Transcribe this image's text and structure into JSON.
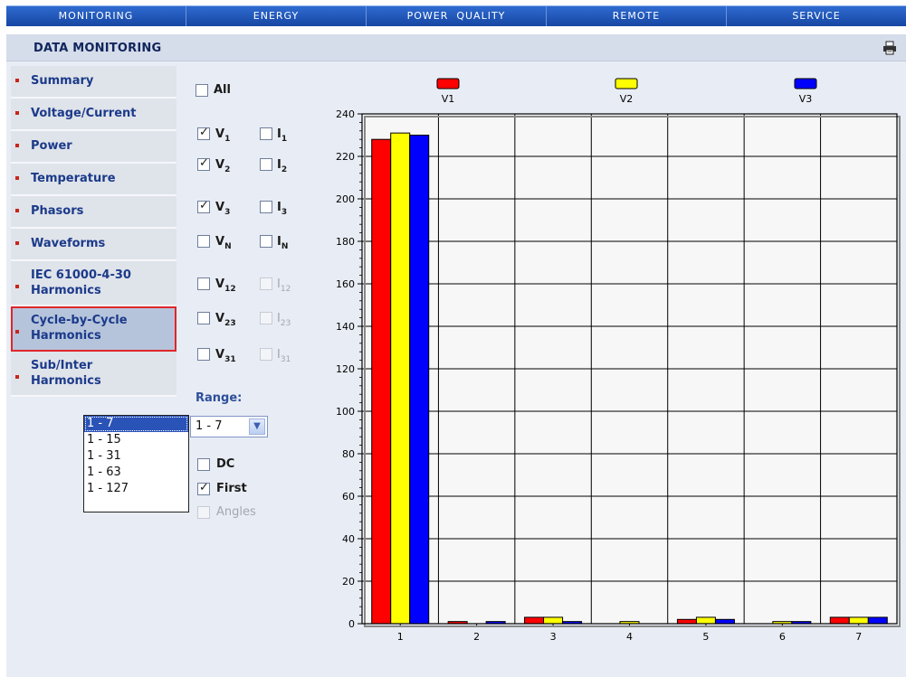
{
  "topnav": {
    "tabs": [
      "MONITORING",
      "ENERGY",
      "POWER  QUALITY",
      "REMOTE",
      "SERVICE"
    ]
  },
  "header": {
    "title": "DATA MONITORING",
    "print_icon": "printer-icon"
  },
  "sidebar": {
    "items": [
      {
        "label": "Summary"
      },
      {
        "label": "Voltage/Current"
      },
      {
        "label": "Power"
      },
      {
        "label": "Temperature"
      },
      {
        "label": "Phasors"
      },
      {
        "label": "Waveforms"
      },
      {
        "label": "IEC 61000-4-30\nHarmonics"
      },
      {
        "label": "Cycle-by-Cycle\nHarmonics",
        "active": true
      },
      {
        "label": "Sub/Inter\nHarmonics"
      }
    ]
  },
  "options": {
    "all": {
      "label": "All",
      "checked": false
    },
    "v1": {
      "label": "V",
      "sub": "1",
      "checked": true
    },
    "i1": {
      "label": "I",
      "sub": "1",
      "checked": false
    },
    "v2": {
      "label": "V",
      "sub": "2",
      "checked": true
    },
    "i2": {
      "label": "I",
      "sub": "2",
      "checked": false
    },
    "v3": {
      "label": "V",
      "sub": "3",
      "checked": true
    },
    "i3": {
      "label": "I",
      "sub": "3",
      "checked": false
    },
    "vn": {
      "label": "V",
      "sub": "N",
      "checked": false
    },
    "in": {
      "label": "I",
      "sub": "N",
      "checked": false
    },
    "v12": {
      "label": "V",
      "sub": "12",
      "checked": false
    },
    "i12": {
      "label": "I",
      "sub": "12",
      "checked": false,
      "disabled": true
    },
    "v23": {
      "label": "V",
      "sub": "23",
      "checked": false
    },
    "i23": {
      "label": "I",
      "sub": "23",
      "checked": false,
      "disabled": true
    },
    "v31": {
      "label": "V",
      "sub": "31",
      "checked": false
    },
    "i31": {
      "label": "I",
      "sub": "31",
      "checked": false,
      "disabled": true
    },
    "dc": {
      "label": "DC",
      "checked": false
    },
    "first": {
      "label": "First",
      "checked": true
    },
    "angles": {
      "label": "Angles",
      "checked": false,
      "disabled": true
    }
  },
  "range": {
    "label": "Range:",
    "selected": "1 - 7",
    "options": [
      "1 - 7",
      "1 - 15",
      "1 - 31",
      "1 - 63",
      "1 - 127"
    ]
  },
  "colors": {
    "V1": "#ff0000",
    "V2": "#ffff00",
    "V3": "#0000ff"
  },
  "chart_data": {
    "type": "bar",
    "categories": [
      "1",
      "2",
      "3",
      "4",
      "5",
      "6",
      "7"
    ],
    "series": [
      {
        "name": "V1",
        "values": [
          228,
          1,
          3,
          0,
          2,
          0,
          3
        ]
      },
      {
        "name": "V2",
        "values": [
          231,
          0,
          3,
          1,
          3,
          1,
          3
        ]
      },
      {
        "name": "V3",
        "values": [
          230,
          1,
          1,
          0,
          2,
          1,
          3
        ]
      }
    ],
    "ylim": [
      0,
      240
    ],
    "yticks": [
      0,
      20,
      40,
      60,
      80,
      100,
      120,
      140,
      160,
      180,
      200,
      220,
      240
    ],
    "grid": true,
    "legend": "top"
  }
}
